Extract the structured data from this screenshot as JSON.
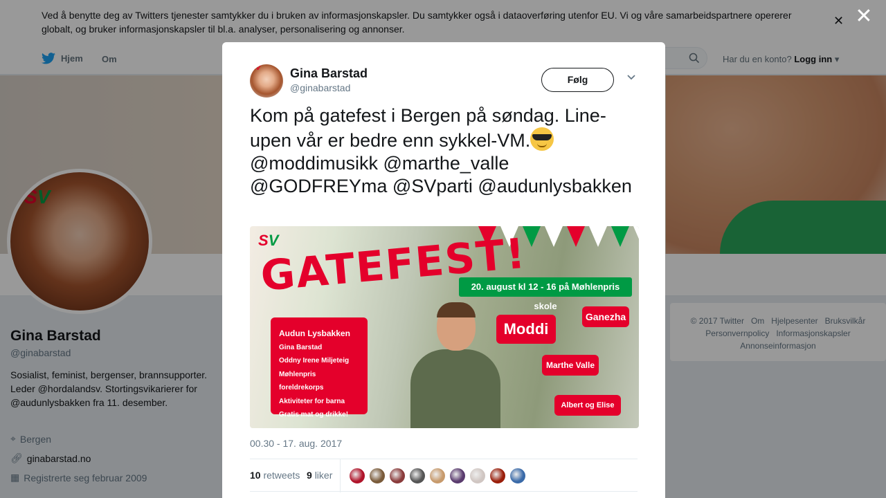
{
  "cookie_banner": {
    "text_1": "Ved å benytte deg av Twitters tjenester samtykker du i bruken av ",
    "link_1": "informasjonskapsler",
    "text_2": ". Du samtykker også i ",
    "link_2": "dataoverføring",
    "text_3": " utenfor EU. Vi og våre samarbeidspartnere opererer globalt, og bruker informasjonskapsler til bl.a. analyser, personalisering og annonser.",
    "close_icon": "close-icon"
  },
  "topnav": {
    "home_label": "Hjem",
    "about_label": "Om",
    "account_prompt": "Har du en konto?",
    "login_label": "Logg inn",
    "brand_color": "#1da1f2"
  },
  "profile": {
    "name": "Gina Barstad",
    "handle": "@ginabarstad",
    "bio": "Sosialist, feminist, bergenser, brannsupporter. Leder @hordalandsv. Stortingsvikarierer for @audunlysbakken fra 11. desember.",
    "location": "Bergen",
    "website": "ginabarstad.no",
    "joined": "Registrerte seg februar 2009"
  },
  "footer": {
    "links": [
      "© 2017 Twitter",
      "Om",
      "Hjelpesenter",
      "Bruksvilkår",
      "Personvernpolicy",
      "Informasjonskapsler",
      "Annonseinformasjon"
    ]
  },
  "tweet": {
    "author_name": "Gina Barstad",
    "author_handle": "@ginabarstad",
    "follow_label": "Følg",
    "text": "Kom på gatefest i Bergen på søndag. Line-upen vår er bedre enn sykkel-VM.",
    "mentions": "@moddimusikk @marthe_valle @GODFREYma @SVparti @audunlysbakken",
    "timestamp": "00.30 - 17. aug. 2017",
    "retweets_count": "10",
    "retweets_label": "retweets",
    "likes_count": "9",
    "likes_label": "liker",
    "liker_colors": [
      "#b0142a",
      "#7a5b3a",
      "#8a3b3b",
      "#555555",
      "#c79a6c",
      "#5a3b6e",
      "#d0c6c2",
      "#9a1e0a",
      "#3a6aa8"
    ]
  },
  "poster": {
    "logo_s": "S",
    "logo_v": "V",
    "title": "GATEFEST!",
    "date_banner": "20. august kl 12 - 16 på Møhlenpris skole",
    "lineup": [
      "Audun Lysbakken",
      "Gina Barstad",
      "Oddny Irene Miljeteig",
      "Møhlenpris foreldrekorps",
      "Aktiviteter for barna",
      "Gratis mat og drikke!"
    ],
    "acts": [
      "Moddi",
      "Ganezha",
      "Marthe Valle",
      "Albert og Elise"
    ],
    "red": "#e4002b",
    "green": "#009a44"
  }
}
